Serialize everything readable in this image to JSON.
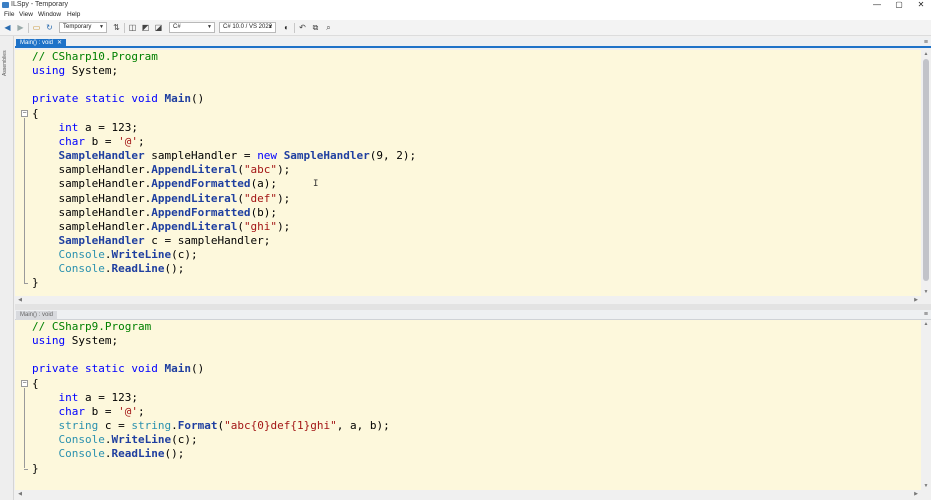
{
  "window": {
    "title": "ILSpy - Temporary",
    "controls": {
      "minimize": "—",
      "maximize": "▢",
      "close": "✕"
    },
    "accent": "#1e72c8"
  },
  "menu": [
    "File",
    "View",
    "Window",
    "Help"
  ],
  "toolbar": {
    "assembly_list": "Temporary",
    "language": "C#",
    "language_version": "C# 10.0 / VS 2022",
    "icons": [
      "back-icon",
      "forward-icon",
      "open-icon",
      "reload-icon",
      "sort-icon",
      "show-public-icon",
      "show-private-icon",
      "show-all-icon",
      "theme-icon",
      "nav-back-icon",
      "nav-forward-icon",
      "new-tab-icon",
      "search-icon"
    ]
  },
  "sidebar": {
    "label": "Assemblies"
  },
  "panes": [
    {
      "tab": "Main() : void",
      "lines": [
        [
          {
            "t": "// CSharp10.Program",
            "c": "comment"
          }
        ],
        [
          {
            "t": "using",
            "c": "kw"
          },
          {
            "t": " System;",
            "c": ""
          }
        ],
        [],
        [
          {
            "t": "private",
            "c": "kw"
          },
          {
            "t": " ",
            "c": ""
          },
          {
            "t": "static",
            "c": "kw"
          },
          {
            "t": " ",
            "c": ""
          },
          {
            "t": "void",
            "c": "kw"
          },
          {
            "t": " ",
            "c": ""
          },
          {
            "t": "Main",
            "c": "method"
          },
          {
            "t": "()",
            "c": ""
          }
        ],
        [
          {
            "t": "{",
            "c": ""
          }
        ],
        [
          {
            "t": "    ",
            "c": ""
          },
          {
            "t": "int",
            "c": "kw"
          },
          {
            "t": " a = 123;",
            "c": ""
          }
        ],
        [
          {
            "t": "    ",
            "c": ""
          },
          {
            "t": "char",
            "c": "kw"
          },
          {
            "t": " b = ",
            "c": ""
          },
          {
            "t": "'@'",
            "c": "str"
          },
          {
            "t": ";",
            "c": ""
          }
        ],
        [
          {
            "t": "    ",
            "c": ""
          },
          {
            "t": "SampleHandler",
            "c": "typename"
          },
          {
            "t": " sampleHandler = ",
            "c": ""
          },
          {
            "t": "new",
            "c": "kw"
          },
          {
            "t": " ",
            "c": ""
          },
          {
            "t": "SampleHandler",
            "c": "typename"
          },
          {
            "t": "(9, 2);",
            "c": ""
          }
        ],
        [
          {
            "t": "    sampleHandler.",
            "c": ""
          },
          {
            "t": "AppendLiteral",
            "c": "method"
          },
          {
            "t": "(",
            "c": ""
          },
          {
            "t": "\"abc\"",
            "c": "str"
          },
          {
            "t": ");",
            "c": ""
          }
        ],
        [
          {
            "t": "    sampleHandler.",
            "c": ""
          },
          {
            "t": "AppendFormatted",
            "c": "method"
          },
          {
            "t": "(a);",
            "c": ""
          }
        ],
        [
          {
            "t": "    sampleHandler.",
            "c": ""
          },
          {
            "t": "AppendLiteral",
            "c": "method"
          },
          {
            "t": "(",
            "c": ""
          },
          {
            "t": "\"def\"",
            "c": "str"
          },
          {
            "t": ");",
            "c": ""
          }
        ],
        [
          {
            "t": "    sampleHandler.",
            "c": ""
          },
          {
            "t": "AppendFormatted",
            "c": "method"
          },
          {
            "t": "(b);",
            "c": ""
          }
        ],
        [
          {
            "t": "    sampleHandler.",
            "c": ""
          },
          {
            "t": "AppendLiteral",
            "c": "method"
          },
          {
            "t": "(",
            "c": ""
          },
          {
            "t": "\"ghi\"",
            "c": "str"
          },
          {
            "t": ");",
            "c": ""
          }
        ],
        [
          {
            "t": "    ",
            "c": ""
          },
          {
            "t": "SampleHandler",
            "c": "typename"
          },
          {
            "t": " c = sampleHandler;",
            "c": ""
          }
        ],
        [
          {
            "t": "    ",
            "c": ""
          },
          {
            "t": "Console",
            "c": "type"
          },
          {
            "t": ".",
            "c": ""
          },
          {
            "t": "WriteLine",
            "c": "method"
          },
          {
            "t": "(c);",
            "c": ""
          }
        ],
        [
          {
            "t": "    ",
            "c": ""
          },
          {
            "t": "Console",
            "c": "type"
          },
          {
            "t": ".",
            "c": ""
          },
          {
            "t": "ReadLine",
            "c": "method"
          },
          {
            "t": "();",
            "c": ""
          }
        ],
        [
          {
            "t": "}",
            "c": ""
          }
        ]
      ]
    },
    {
      "tab": "Main() : void",
      "lines": [
        [
          {
            "t": "// CSharp9.Program",
            "c": "comment"
          }
        ],
        [
          {
            "t": "using",
            "c": "kw"
          },
          {
            "t": " System;",
            "c": ""
          }
        ],
        [],
        [
          {
            "t": "private",
            "c": "kw"
          },
          {
            "t": " ",
            "c": ""
          },
          {
            "t": "static",
            "c": "kw"
          },
          {
            "t": " ",
            "c": ""
          },
          {
            "t": "void",
            "c": "kw"
          },
          {
            "t": " ",
            "c": ""
          },
          {
            "t": "Main",
            "c": "method"
          },
          {
            "t": "()",
            "c": ""
          }
        ],
        [
          {
            "t": "{",
            "c": ""
          }
        ],
        [
          {
            "t": "    ",
            "c": ""
          },
          {
            "t": "int",
            "c": "kw"
          },
          {
            "t": " a = 123;",
            "c": ""
          }
        ],
        [
          {
            "t": "    ",
            "c": ""
          },
          {
            "t": "char",
            "c": "kw"
          },
          {
            "t": " b = ",
            "c": ""
          },
          {
            "t": "'@'",
            "c": "str"
          },
          {
            "t": ";",
            "c": ""
          }
        ],
        [
          {
            "t": "    ",
            "c": ""
          },
          {
            "t": "string",
            "c": "type"
          },
          {
            "t": " c = ",
            "c": ""
          },
          {
            "t": "string",
            "c": "type"
          },
          {
            "t": ".",
            "c": ""
          },
          {
            "t": "Format",
            "c": "method"
          },
          {
            "t": "(",
            "c": ""
          },
          {
            "t": "\"abc{0}def{1}ghi\"",
            "c": "str"
          },
          {
            "t": ", a, b);",
            "c": ""
          }
        ],
        [
          {
            "t": "    ",
            "c": ""
          },
          {
            "t": "Console",
            "c": "type"
          },
          {
            "t": ".",
            "c": ""
          },
          {
            "t": "WriteLine",
            "c": "method"
          },
          {
            "t": "(c);",
            "c": ""
          }
        ],
        [
          {
            "t": "    ",
            "c": ""
          },
          {
            "t": "Console",
            "c": "type"
          },
          {
            "t": ".",
            "c": ""
          },
          {
            "t": "ReadLine",
            "c": "method"
          },
          {
            "t": "();",
            "c": ""
          }
        ],
        [
          {
            "t": "}",
            "c": ""
          }
        ]
      ]
    }
  ]
}
